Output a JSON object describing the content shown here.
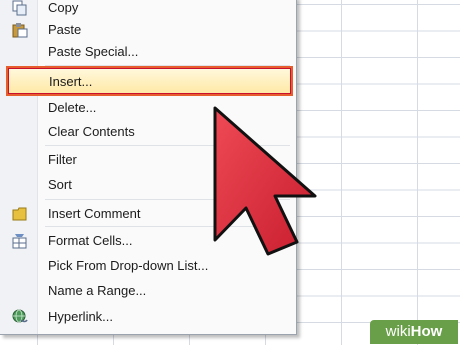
{
  "menu": {
    "items": [
      {
        "label": "Copy",
        "icon": "copy-icon"
      },
      {
        "label": "Paste",
        "icon": "paste-icon"
      },
      {
        "label": "Paste Special...",
        "icon": ""
      },
      {
        "label": "Insert...",
        "icon": "",
        "highlighted": true
      },
      {
        "label": "Delete...",
        "icon": ""
      },
      {
        "label": "Clear Contents",
        "icon": ""
      },
      {
        "label": "Filter",
        "icon": ""
      },
      {
        "label": "Sort",
        "icon": ""
      },
      {
        "label": "Insert Comment",
        "icon": "comment-icon"
      },
      {
        "label": "Format Cells...",
        "icon": "format-cells-icon"
      },
      {
        "label": "Pick From Drop-down List...",
        "icon": ""
      },
      {
        "label": "Name a Range...",
        "icon": ""
      },
      {
        "label": "Hyperlink...",
        "icon": "hyperlink-icon"
      }
    ]
  },
  "watermark": {
    "wiki": "wiki",
    "how": "How"
  },
  "colors": {
    "highlight_border": "#e65d2e",
    "arrow": "#d8283a",
    "logo_bg": "#6a9f4a"
  }
}
